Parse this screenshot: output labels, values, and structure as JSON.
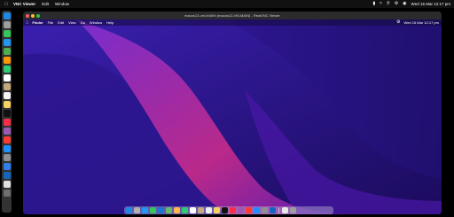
{
  "host_menubar": {
    "app_name": "VNC Viewer",
    "menus": [
      "Edit",
      "Window"
    ],
    "clock": "Wed 15 Mar  12:17 pm"
  },
  "host_dock": {
    "icons": [
      {
        "name": "finder-icon",
        "color": "#1e88e5"
      },
      {
        "name": "launchpad-icon",
        "color": "#9e9e9e"
      },
      {
        "name": "messages-icon",
        "color": "#34c759"
      },
      {
        "name": "mail-icon",
        "color": "#2196f3"
      },
      {
        "name": "maps-icon",
        "color": "#4caf50"
      },
      {
        "name": "photos-icon",
        "color": "#ff9800"
      },
      {
        "name": "facetime-icon",
        "color": "#2ecc71"
      },
      {
        "name": "calendar-icon",
        "color": "#ffffff"
      },
      {
        "name": "contacts-icon",
        "color": "#c8a97e"
      },
      {
        "name": "reminders-icon",
        "color": "#f5f5f5"
      },
      {
        "name": "notes-icon",
        "color": "#f4d35e"
      },
      {
        "name": "tv-icon",
        "color": "#111111"
      },
      {
        "name": "music-icon",
        "color": "#fa2d48"
      },
      {
        "name": "podcasts-icon",
        "color": "#9b59b6"
      },
      {
        "name": "news-icon",
        "color": "#ff3b30"
      },
      {
        "name": "app-store-icon",
        "color": "#1e90ff"
      },
      {
        "name": "settings-icon",
        "color": "#8e8e93"
      },
      {
        "name": "vnc-icon",
        "color": "#2f80ed"
      },
      {
        "name": "xcode-icon",
        "color": "#1565c0"
      },
      {
        "name": "document-icon",
        "color": "#e0e0e0"
      },
      {
        "name": "trash-icon",
        "color": "#6e6e6e"
      }
    ]
  },
  "vnc_window": {
    "title": "macos13-vm-fr44hh (macos13-VM-MAIN) - RealVNC Viewer"
  },
  "guest_menubar": {
    "menus": [
      "Finder",
      "File",
      "Edit",
      "View",
      "Go",
      "Window",
      "Help"
    ],
    "clock": "Wed 15 Mar  12:17 pm"
  },
  "guest_dock": {
    "icons": [
      {
        "name": "finder-icon",
        "color": "#1e88e5"
      },
      {
        "name": "launchpad-icon",
        "color": "#b0b0b0"
      },
      {
        "name": "safari-icon",
        "color": "#2196f3"
      },
      {
        "name": "messages-icon",
        "color": "#34c759"
      },
      {
        "name": "mail-icon",
        "color": "#1976d2"
      },
      {
        "name": "maps-icon",
        "color": "#66bb6a"
      },
      {
        "name": "photos-icon",
        "color": "#ffb74d"
      },
      {
        "name": "facetime-icon",
        "color": "#2ecc71"
      },
      {
        "name": "calendar-icon",
        "color": "#ffffff"
      },
      {
        "name": "contacts-icon",
        "color": "#c8a97e"
      },
      {
        "name": "reminders-icon",
        "color": "#eeeeee"
      },
      {
        "name": "notes-icon",
        "color": "#f4d35e"
      },
      {
        "name": "tv-icon",
        "color": "#111111"
      },
      {
        "name": "music-icon",
        "color": "#fa2d48"
      },
      {
        "name": "podcasts-icon",
        "color": "#9b59b6"
      },
      {
        "name": "news-icon",
        "color": "#ff3b30"
      },
      {
        "name": "app-store-icon",
        "color": "#1e90ff"
      },
      {
        "name": "settings-icon",
        "color": "#8e8e93"
      },
      {
        "name": "xcode-icon",
        "color": "#1565c0"
      }
    ],
    "trailing_icons": [
      {
        "name": "document-icon",
        "color": "#e8e8e8"
      },
      {
        "name": "trash-icon",
        "color": "#9e9e9e"
      }
    ]
  },
  "colors": {
    "wallpaper_light": "#c12a8a",
    "wallpaper_mid": "#5a1db5",
    "wallpaper_dark": "#1b0b5c"
  }
}
